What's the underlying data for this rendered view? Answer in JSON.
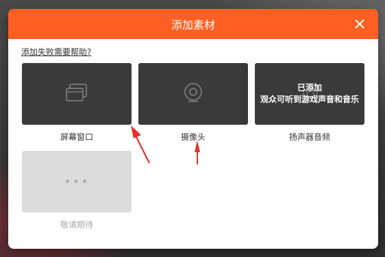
{
  "dialog": {
    "title": "添加素材",
    "help_link": "添加失败需要帮助?",
    "close_icon": "close-icon"
  },
  "cards": [
    {
      "label": "屏幕窗口",
      "icon": "screen-window-icon"
    },
    {
      "label": "摄像头",
      "icon": "camera-icon"
    },
    {
      "label": "扬声器音频",
      "icon": "speaker-icon",
      "status_line1": "已添加",
      "status_line2": "观众可听到游戏声音和音乐"
    },
    {
      "label": "敬请期待",
      "icon": "more-icon",
      "dots": "•••"
    }
  ],
  "colors": {
    "accent": "#ff5f22",
    "card_dark": "#3a3a3a",
    "card_light": "#dcdcdc",
    "annotation_arrow": "#e8302a"
  }
}
